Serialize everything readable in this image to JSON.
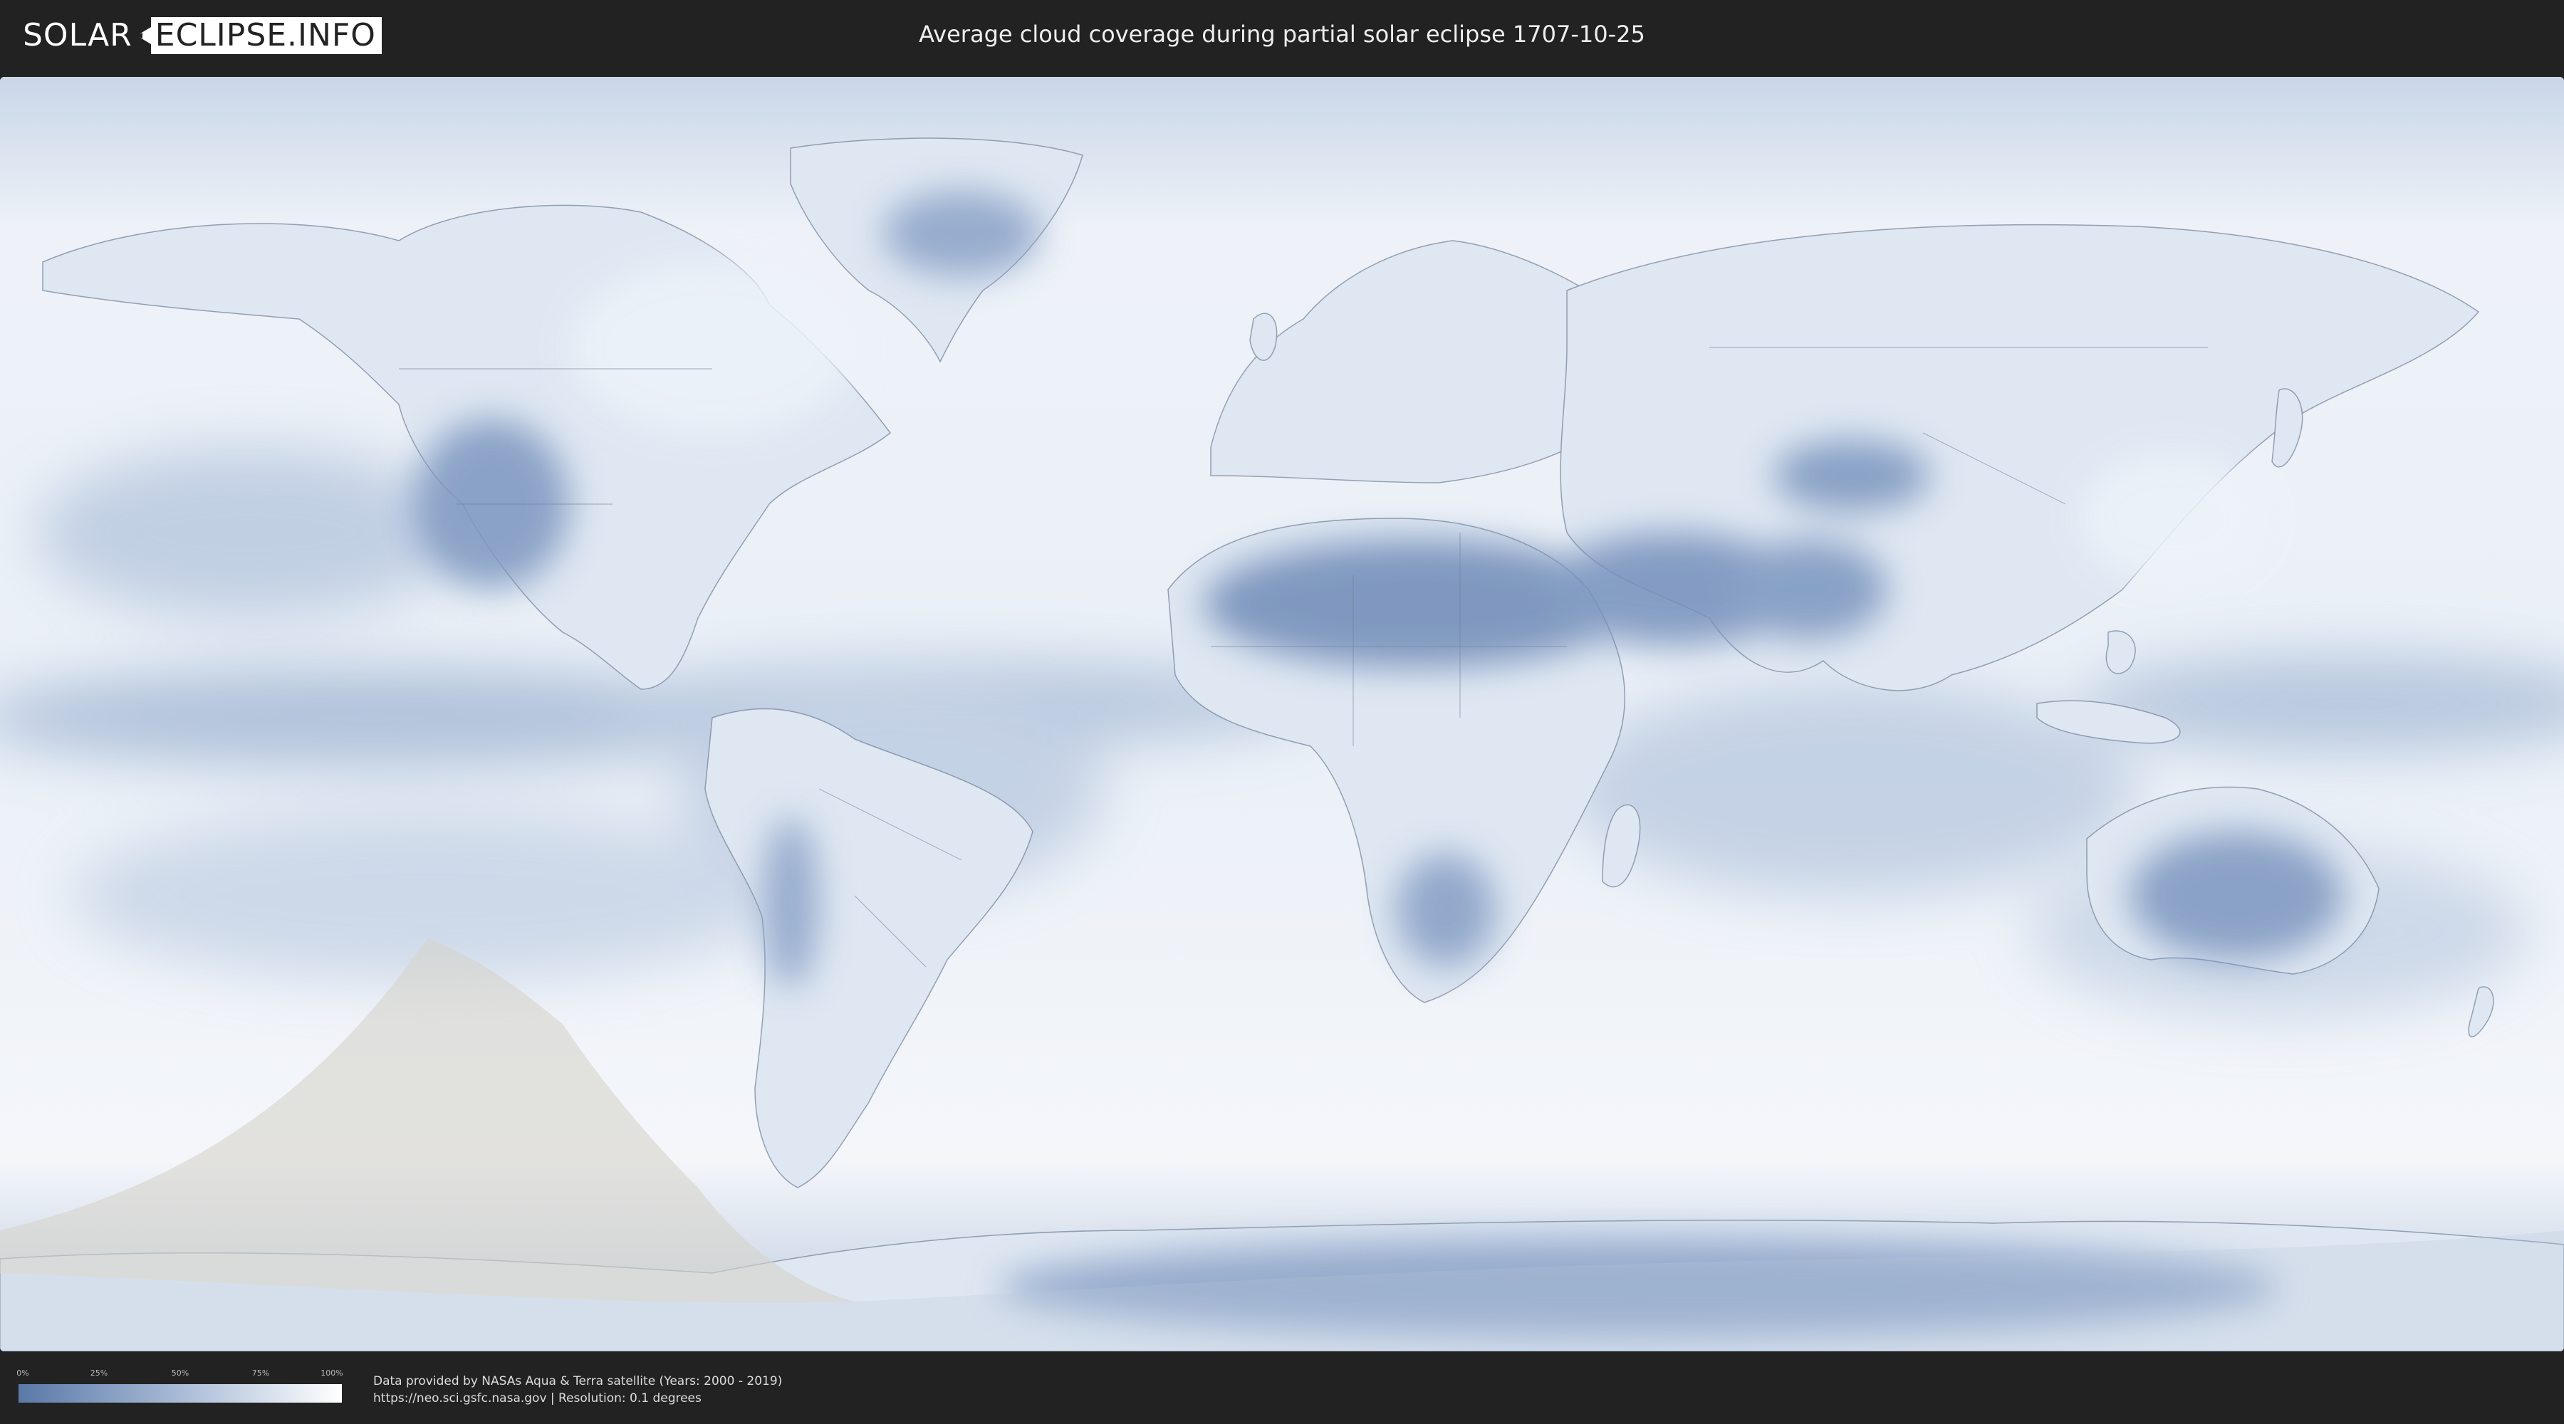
{
  "header": {
    "logo_part1": "SOLAR",
    "logo_part2": "ECLIPSE.INFO",
    "title": "Average cloud coverage during partial solar eclipse 1707-10-25"
  },
  "map": {
    "description_icon": "world-map-icon",
    "colors": {
      "clear_sky": "#5a79a8",
      "cloudy": "#ffffff",
      "shadow_overlay": "#d6d3cc",
      "border": "#6e7f95"
    }
  },
  "legend": {
    "ticks": [
      "0%",
      "25%",
      "50%",
      "75%",
      "100%"
    ]
  },
  "footer": {
    "credit_line1": "Data provided by NASAs Aqua & Terra satellite (Years: 2000 - 2019)",
    "credit_line2": "https://neo.sci.gsfc.nasa.gov | Resolution: 0.1 degrees"
  }
}
